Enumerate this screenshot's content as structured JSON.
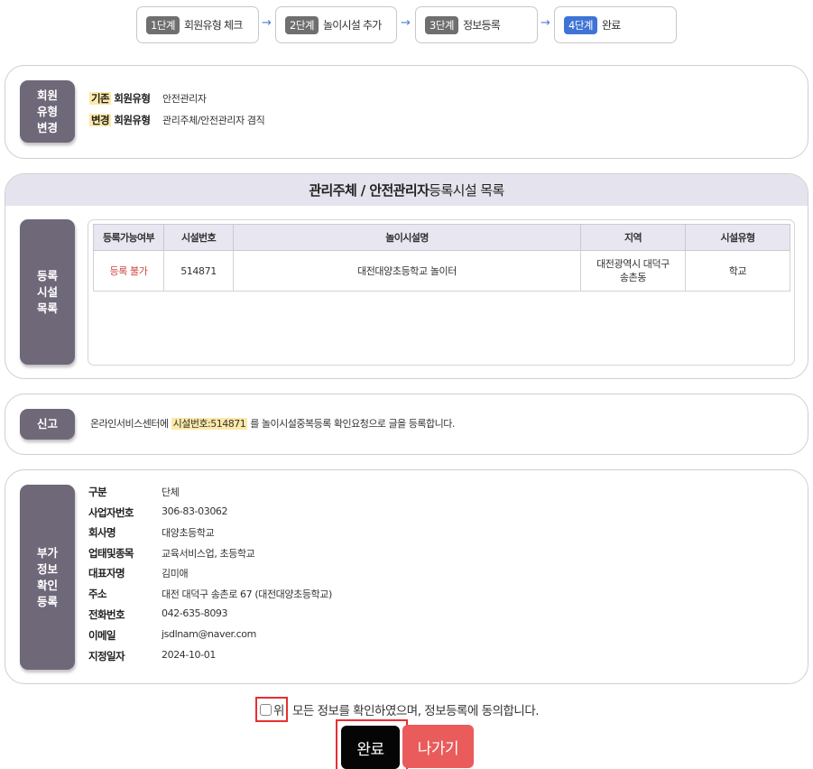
{
  "steps": [
    {
      "badge": "1단계",
      "label": "회원유형 체크"
    },
    {
      "badge": "2단계",
      "label": "놀이시설 추가"
    },
    {
      "badge": "3단계",
      "label": "정보등록"
    },
    {
      "badge": "4단계",
      "label": "완료"
    }
  ],
  "arrow": "→",
  "member_change": {
    "side_label": "회원\n유형\n변경",
    "rows": [
      {
        "tag": "기존",
        "key": "회원유형",
        "value": "안전관리자"
      },
      {
        "tag": "변경",
        "key": "회원유형",
        "value": "관리주체/안전관리자 겸직"
      }
    ]
  },
  "registration": {
    "title_bold": "관리주체 / 안전관리자",
    "title_rest": " 등록시설 목록",
    "side_label": "등록\n시설\n목록",
    "columns": [
      "등록가능여부",
      "시설번호",
      "놀이시설명",
      "지역",
      "시설유형"
    ],
    "rows": [
      {
        "status": "등록 불가",
        "number": "514871",
        "name": "대전대양초등학교 놀이터",
        "region": "대전광역시 대덕구\n송촌동",
        "type": "학교"
      }
    ]
  },
  "report": {
    "side_label": "신고",
    "text_before": "온라인서비스센터에 ",
    "highlight": "시설번호:514871",
    "text_after": " 를 놀이시설중복등록 확인요청으로 글을 등록합니다."
  },
  "extra_info": {
    "side_label": "부가\n정보\n확인\n등록",
    "rows": [
      {
        "key": "구분",
        "value": "단체"
      },
      {
        "key": "사업자번호",
        "value": "306-83-03062"
      },
      {
        "key": "회사명",
        "value": "대양초등학교"
      },
      {
        "key": "업태및종목",
        "value": "교육서비스업, 초등학교"
      },
      {
        "key": "대표자명",
        "value": "김미애"
      },
      {
        "key": "주소",
        "value": "대전 대덕구 송촌로 67 (대전대양초등학교)"
      },
      {
        "key": "전화번호",
        "value": "042-635-8093"
      },
      {
        "key": "이메일",
        "value": "jsdlnam@naver.com"
      },
      {
        "key": "지정일자",
        "value": "2024-10-01"
      }
    ]
  },
  "agree": {
    "prefix": "위",
    "text": " 모든 정보를 확인하였으며, 정보등록에 동의합니다."
  },
  "buttons": {
    "done": "완료",
    "exit": "나가기"
  },
  "colors": {
    "accent_step": "#3f74d6",
    "side_label": "#6e6879",
    "danger": "#ea5b5b",
    "highlight": "#fde9a8"
  }
}
